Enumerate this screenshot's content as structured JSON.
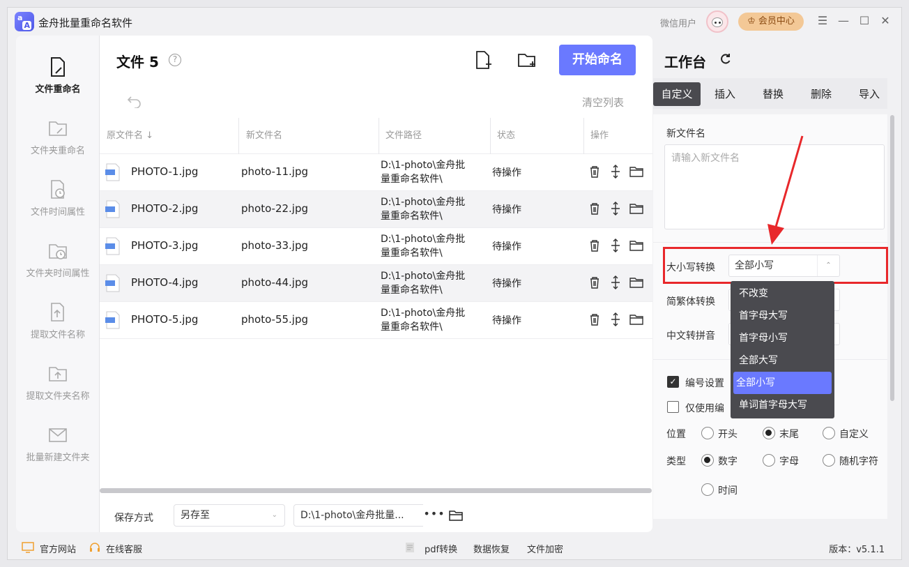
{
  "app": {
    "title": "金舟批量重命名软件",
    "user": "微信用户",
    "vip_label": "会员中心",
    "logo_text_a": "a",
    "logo_text_b": "A"
  },
  "sidebar": {
    "items": [
      {
        "label": "文件重命名",
        "icon": "file-edit-icon",
        "active": true
      },
      {
        "label": "文件夹重命名",
        "icon": "folder-edit-icon"
      },
      {
        "label": "文件时间属性",
        "icon": "file-clock-icon"
      },
      {
        "label": "文件夹时间属性",
        "icon": "folder-clock-icon"
      },
      {
        "label": "提取文件名称",
        "icon": "file-export-icon"
      },
      {
        "label": "提取文件夹名称",
        "icon": "folder-export-icon"
      },
      {
        "label": "批量新建文件夹",
        "icon": "mail-folder-icon"
      }
    ]
  },
  "main": {
    "title": "文件 5",
    "help": "?",
    "start_button": "开始命名",
    "clear_list": "清空列表",
    "columns": [
      "原文件名 ↓",
      "新文件名",
      "文件路径",
      "状态",
      "操作"
    ],
    "rows": [
      {
        "old": "PHOTO-1.jpg",
        "new": "photo-11.jpg",
        "path": "D:\\1-photo\\金舟批量重命名软件\\",
        "status": "待操作"
      },
      {
        "old": "PHOTO-2.jpg",
        "new": "photo-22.jpg",
        "path": "D:\\1-photo\\金舟批量重命名软件\\",
        "status": "待操作"
      },
      {
        "old": "PHOTO-3.jpg",
        "new": "photo-33.jpg",
        "path": "D:\\1-photo\\金舟批量重命名软件\\",
        "status": "待操作"
      },
      {
        "old": "PHOTO-4.jpg",
        "new": "photo-44.jpg",
        "path": "D:\\1-photo\\金舟批量重命名软件\\",
        "status": "待操作"
      },
      {
        "old": "PHOTO-5.jpg",
        "new": "photo-55.jpg",
        "path": "D:\\1-photo\\金舟批量重命名软件\\",
        "status": "待操作"
      }
    ],
    "save_label": "保存方式",
    "save_mode": "另存至",
    "save_path": "D:\\1-photo\\金舟批量...",
    "more": "•••"
  },
  "workbench": {
    "title": "工作台",
    "tabs": [
      "自定义",
      "插入",
      "替换",
      "删除",
      "导入"
    ],
    "new_name_label": "新文件名",
    "new_name_placeholder": "请输入新文件名",
    "case_label": "大小写转换",
    "case_value": "全部小写",
    "case_options": [
      "不改变",
      "首字母大写",
      "首字母小写",
      "全部大写",
      "全部小写",
      "单词首字母大写"
    ],
    "simp_trad_label": "简繁体转换",
    "pinyin_label": "中文转拼音",
    "numbering_label": "编号设置",
    "numbering_checked": true,
    "only_numbering_label": "仅使用编",
    "only_numbering_checked": false,
    "position_label": "位置",
    "position_options": [
      "开头",
      "末尾",
      "自定义"
    ],
    "position_selected": "末尾",
    "type_label": "类型",
    "type_options": [
      "数字",
      "字母",
      "随机字符",
      "时间"
    ],
    "type_selected": "数字"
  },
  "footer": {
    "official_site": "官方网站",
    "online_service": "在线客服",
    "pdf": "pdf转换",
    "recovery": "数据恢复",
    "encrypt": "文件加密",
    "version": "版本：v5.1.1"
  },
  "colors": {
    "accent": "#6a79ff",
    "highlight": "#e8282b",
    "dark_tab": "#4a4a4f"
  }
}
